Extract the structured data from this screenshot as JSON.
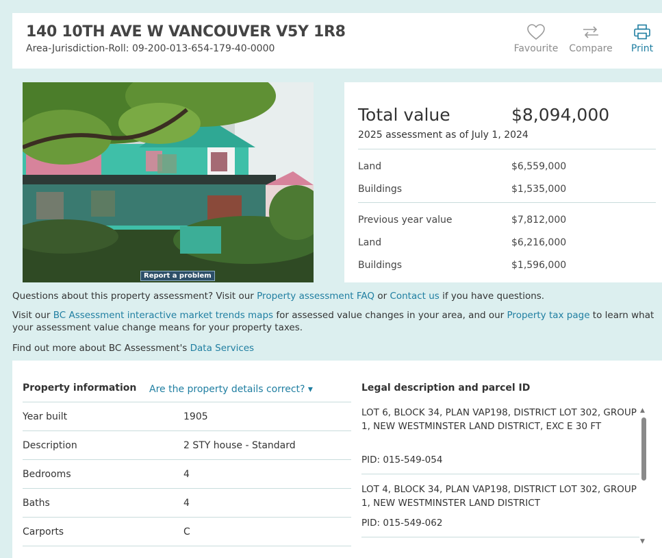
{
  "header": {
    "address": "140 10TH AVE W VANCOUVER V5Y 1R8",
    "roll": "Area-Jurisdiction-Roll: 09-200-013-654-179-40-0000",
    "actions": {
      "favourite": "Favourite",
      "compare": "Compare",
      "print": "Print"
    }
  },
  "photo": {
    "report_label": "Report a problem"
  },
  "value": {
    "total_label": "Total value",
    "total_amount": "$8,094,000",
    "assessment_note": "2025 assessment as of July 1, 2024",
    "current": [
      {
        "label": "Land",
        "value": "$6,559,000"
      },
      {
        "label": "Buildings",
        "value": "$1,535,000"
      }
    ],
    "previous_label": "Previous year value",
    "previous_total": "$7,812,000",
    "previous": [
      {
        "label": "Land",
        "value": "$6,216,000"
      },
      {
        "label": "Buildings",
        "value": "$1,596,000"
      }
    ]
  },
  "info": {
    "q_prefix": "Questions about this property assessment? Visit our ",
    "q_link1": "Property assessment FAQ",
    "q_mid": " or ",
    "q_link2": "Contact us",
    "q_suffix": " if you have questions.",
    "v_prefix": "Visit our ",
    "v_link1": "BC Assessment interactive market trends maps",
    "v_mid": " for assessed value changes in your area, and our ",
    "v_link2": "Property tax page",
    "v_suffix": " to learn what your assessment value change means for your property taxes.",
    "f_prefix": "Find out more about BC Assessment's ",
    "f_link": "Data Services"
  },
  "property_info": {
    "title": "Property information",
    "details_link": "Are the property details correct? ▾",
    "rows": [
      {
        "label": "Year built",
        "value": "1905"
      },
      {
        "label": "Description",
        "value": "2 STY house - Standard"
      },
      {
        "label": "Bedrooms",
        "value": "4"
      },
      {
        "label": "Baths",
        "value": "4"
      },
      {
        "label": "Carports",
        "value": "C"
      }
    ]
  },
  "legal": {
    "title": "Legal description and parcel ID",
    "entries": [
      {
        "description": "LOT 6, BLOCK 34, PLAN VAP198, DISTRICT LOT 302, GROUP 1, NEW WESTMINSTER LAND DISTRICT, EXC E 30 FT",
        "pid": "PID: 015-549-054"
      },
      {
        "description": "LOT 4, BLOCK 34, PLAN VAP198, DISTRICT LOT 302, GROUP 1, NEW WESTMINSTER LAND DISTRICT",
        "pid": "PID: 015-549-062"
      }
    ]
  },
  "colors": {
    "page_bg": "#dcefef",
    "link": "#1f7ea1",
    "report_bg": "#2d4f68"
  }
}
